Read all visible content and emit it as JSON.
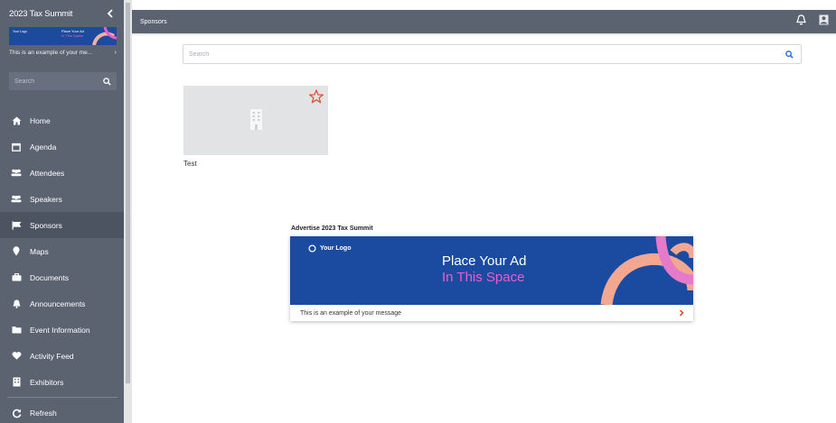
{
  "sidebar": {
    "title": "2023 Tax Summit",
    "banner": {
      "logo_text": "Your Logo",
      "line1": "Place Your Ad",
      "line2": "In This Space"
    },
    "message": "This is an example of your me...",
    "search_placeholder": "Search",
    "items": [
      {
        "label": "Home",
        "icon": "home-icon"
      },
      {
        "label": "Agenda",
        "icon": "calendar-icon"
      },
      {
        "label": "Attendees",
        "icon": "people-icon"
      },
      {
        "label": "Speakers",
        "icon": "people-icon"
      },
      {
        "label": "Sponsors",
        "icon": "flag-icon",
        "active": true
      },
      {
        "label": "Maps",
        "icon": "map-pin-icon"
      },
      {
        "label": "Documents",
        "icon": "briefcase-icon"
      },
      {
        "label": "Announcements",
        "icon": "bell-icon"
      },
      {
        "label": "Event Information",
        "icon": "folder-icon"
      },
      {
        "label": "Activity Feed",
        "icon": "heart-icon"
      },
      {
        "label": "Exhibitors",
        "icon": "building-icon"
      }
    ],
    "refresh_label": "Refresh"
  },
  "topbar": {
    "title": "Sponsors"
  },
  "main": {
    "search_placeholder": "Search",
    "sponsor": {
      "name": "Test"
    },
    "ad": {
      "title": "Advertise 2023 Tax Summit",
      "logo_text": "Your Logo",
      "line1": "Place Your Ad",
      "line2": "In This Space",
      "message": "This is an example of your message"
    }
  },
  "colors": {
    "sidebar": "#5b6371",
    "ad_blue": "#1b4ba0",
    "ad_pink": "#e95ec8",
    "star": "#e0513a",
    "search_icon": "#2a6fd6"
  }
}
